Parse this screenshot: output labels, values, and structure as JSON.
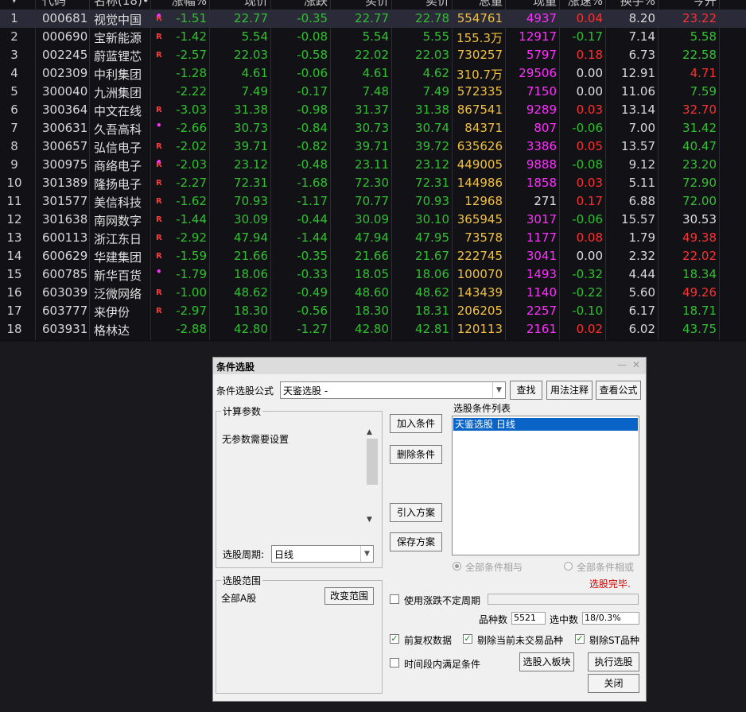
{
  "table": {
    "headers": {
      "code": "代码",
      "name": "名称(18)•",
      "change_pct": "涨幅%",
      "last": "现价",
      "change": "涨跌",
      "buy": "买价",
      "sell": "卖价",
      "volume": "总量",
      "cur_volume": "现量",
      "speed": "涨速%",
      "turnover": "换手%",
      "open": "今开"
    },
    "rows": [
      {
        "idx": "1",
        "code": "000681",
        "name": "视觉中国",
        "mark": "R",
        "mark_type": "both",
        "chg": "-1.51",
        "last": "22.77",
        "diff": "-0.35",
        "buy": "22.77",
        "sell": "22.78",
        "vol": "554761",
        "cur": "4937",
        "spd": "0.04",
        "turn": "8.20",
        "open": "23.22",
        "selected": true
      },
      {
        "idx": "2",
        "code": "000690",
        "name": "宝新能源",
        "mark": "R",
        "mark_type": "r",
        "chg": "-1.42",
        "last": "5.54",
        "diff": "-0.08",
        "buy": "5.54",
        "sell": "5.55",
        "vol": "155.3万",
        "cur": "12917",
        "spd": "-0.17",
        "turn": "7.14",
        "open": "5.58"
      },
      {
        "idx": "3",
        "code": "002245",
        "name": "蔚蓝锂芯",
        "mark": "R",
        "mark_type": "r",
        "chg": "-2.57",
        "last": "22.03",
        "diff": "-0.58",
        "buy": "22.02",
        "sell": "22.03",
        "vol": "730257",
        "cur": "5797",
        "spd": "0.18",
        "turn": "6.73",
        "open": "22.58"
      },
      {
        "idx": "4",
        "code": "002309",
        "name": "中利集团",
        "mark": "",
        "mark_type": "",
        "chg": "-1.28",
        "last": "4.61",
        "diff": "-0.06",
        "buy": "4.61",
        "sell": "4.62",
        "vol": "310.7万",
        "cur": "29506",
        "spd": "0.00",
        "turn": "12.91",
        "open": "4.71"
      },
      {
        "idx": "5",
        "code": "300040",
        "name": "九洲集团",
        "mark": "",
        "mark_type": "",
        "chg": "-2.22",
        "last": "7.49",
        "diff": "-0.17",
        "buy": "7.48",
        "sell": "7.49",
        "vol": "572335",
        "cur": "7150",
        "spd": "0.00",
        "turn": "11.06",
        "open": "7.59"
      },
      {
        "idx": "6",
        "code": "300364",
        "name": "中文在线",
        "mark": "R",
        "mark_type": "r",
        "chg": "-3.03",
        "last": "31.38",
        "diff": "-0.98",
        "buy": "31.37",
        "sell": "31.38",
        "vol": "867541",
        "cur": "9289",
        "spd": "0.03",
        "turn": "13.14",
        "open": "32.70"
      },
      {
        "idx": "7",
        "code": "300631",
        "name": "久吾高科",
        "mark": "•",
        "mark_type": "dot",
        "chg": "-2.66",
        "last": "30.73",
        "diff": "-0.84",
        "buy": "30.73",
        "sell": "30.74",
        "vol": "84371",
        "cur": "807",
        "spd": "-0.06",
        "turn": "7.00",
        "open": "31.42"
      },
      {
        "idx": "8",
        "code": "300657",
        "name": "弘信电子",
        "mark": "R",
        "mark_type": "r",
        "chg": "-2.02",
        "last": "39.71",
        "diff": "-0.82",
        "buy": "39.71",
        "sell": "39.72",
        "vol": "635626",
        "cur": "3386",
        "spd": "0.05",
        "turn": "13.57",
        "open": "40.47"
      },
      {
        "idx": "9",
        "code": "300975",
        "name": "商络电子",
        "mark": "R",
        "mark_type": "both",
        "chg": "-2.03",
        "last": "23.12",
        "diff": "-0.48",
        "buy": "23.11",
        "sell": "23.12",
        "vol": "449005",
        "cur": "9888",
        "spd": "-0.08",
        "turn": "9.12",
        "open": "23.20"
      },
      {
        "idx": "10",
        "code": "301389",
        "name": "隆扬电子",
        "mark": "R",
        "mark_type": "r",
        "chg": "-2.27",
        "last": "72.31",
        "diff": "-1.68",
        "buy": "72.30",
        "sell": "72.31",
        "vol": "144986",
        "cur": "1858",
        "spd": "0.03",
        "turn": "5.11",
        "open": "72.90"
      },
      {
        "idx": "11",
        "code": "301577",
        "name": "美信科技",
        "mark": "R",
        "mark_type": "r",
        "chg": "-1.62",
        "last": "70.93",
        "diff": "-1.17",
        "buy": "70.77",
        "sell": "70.93",
        "vol": "12968",
        "cur": "271",
        "spd": "0.17",
        "turn": "6.88",
        "open": "72.00"
      },
      {
        "idx": "12",
        "code": "301638",
        "name": "南网数字",
        "mark": "R",
        "mark_type": "r",
        "chg": "-1.44",
        "last": "30.09",
        "diff": "-0.44",
        "buy": "30.09",
        "sell": "30.10",
        "vol": "365945",
        "cur": "3017",
        "spd": "-0.06",
        "turn": "15.57",
        "open": "30.53"
      },
      {
        "idx": "13",
        "code": "600113",
        "name": "浙江东日",
        "mark": "R",
        "mark_type": "r",
        "chg": "-2.92",
        "last": "47.94",
        "diff": "-1.44",
        "buy": "47.94",
        "sell": "47.95",
        "vol": "73578",
        "cur": "1177",
        "spd": "0.08",
        "turn": "1.79",
        "open": "49.38"
      },
      {
        "idx": "14",
        "code": "600629",
        "name": "华建集团",
        "mark": "R",
        "mark_type": "r",
        "chg": "-1.59",
        "last": "21.66",
        "diff": "-0.35",
        "buy": "21.66",
        "sell": "21.67",
        "vol": "222745",
        "cur": "3041",
        "spd": "0.00",
        "turn": "2.32",
        "open": "22.02"
      },
      {
        "idx": "15",
        "code": "600785",
        "name": "新华百货",
        "mark": "•",
        "mark_type": "dot",
        "chg": "-1.79",
        "last": "18.06",
        "diff": "-0.33",
        "buy": "18.05",
        "sell": "18.06",
        "vol": "100070",
        "cur": "1493",
        "spd": "-0.32",
        "turn": "4.44",
        "open": "18.34"
      },
      {
        "idx": "16",
        "code": "603039",
        "name": "泛微网络",
        "mark": "R",
        "mark_type": "r",
        "chg": "-1.00",
        "last": "48.62",
        "diff": "-0.49",
        "buy": "48.60",
        "sell": "48.62",
        "vol": "143439",
        "cur": "1140",
        "spd": "-0.22",
        "turn": "5.60",
        "open": "49.26"
      },
      {
        "idx": "17",
        "code": "603777",
        "name": "来伊份",
        "mark": "R",
        "mark_type": "r",
        "chg": "-2.97",
        "last": "18.30",
        "diff": "-0.56",
        "buy": "18.30",
        "sell": "18.31",
        "vol": "206205",
        "cur": "2257",
        "spd": "-0.10",
        "turn": "6.17",
        "open": "18.71"
      },
      {
        "idx": "18",
        "code": "603931",
        "name": "格林达",
        "mark": "",
        "mark_type": "",
        "chg": "-2.88",
        "last": "42.80",
        "diff": "-1.27",
        "buy": "42.80",
        "sell": "42.81",
        "vol": "120113",
        "cur": "2161",
        "spd": "0.02",
        "turn": "6.02",
        "open": "43.75"
      }
    ]
  },
  "dialog": {
    "title": "条件选股",
    "formula_label": "条件选股公式",
    "formula_value": "天鉴选股   -",
    "find_btn": "查找",
    "usage_btn": "用法注释",
    "view_btn": "查看公式",
    "params_group": "计算参数",
    "params_text": "无参数需要设置",
    "period_label": "选股周期:",
    "period_value": "日线",
    "range_group": "选股范围",
    "range_value": "全部A股",
    "change_range_btn": "改变范围",
    "add_cond_btn": "加入条件",
    "del_cond_btn": "删除条件",
    "import_btn": "引入方案",
    "save_btn": "保存方案",
    "list_label": "选股条件列表",
    "list_items": [
      "天鉴选股  日线"
    ],
    "radio_and": "全部条件相与",
    "radio_or": "全部条件相或",
    "status": "选股完毕.",
    "use_variable_period": "使用涨跌不定周期",
    "count_label": "品种数",
    "count_value": "5521",
    "selected_label": "选中数",
    "selected_value": "18/0.3%",
    "chk_adjust": "前复权数据",
    "chk_exclude_untraded": "剔除当前未交易品种",
    "chk_exclude_st": "剔除ST品种",
    "chk_time_range": "时间段内满足条件",
    "to_block_btn": "选股入板块",
    "run_btn": "执行选股",
    "close_btn": "关闭",
    "checks": {
      "adjust": true,
      "exclude_untraded": true,
      "exclude_st": true,
      "time_range": false,
      "variable_period": false
    }
  }
}
